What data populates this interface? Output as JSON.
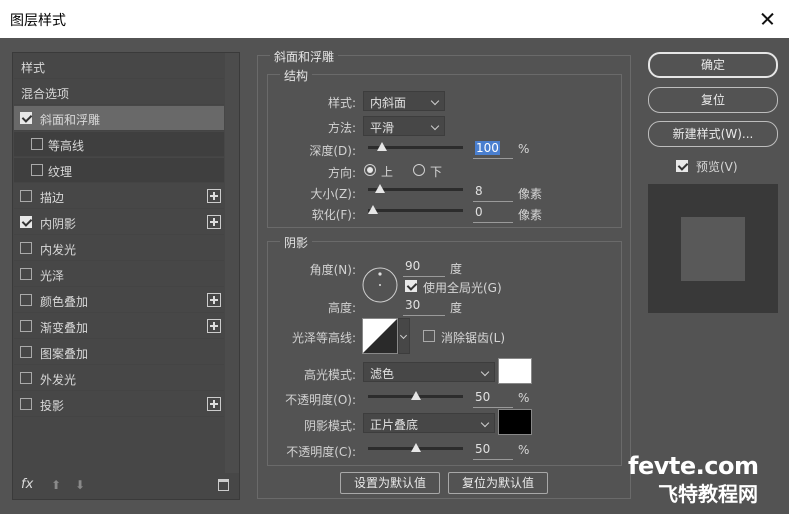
{
  "window": {
    "title": "图层样式"
  },
  "left_panel": {
    "items": [
      {
        "label": "样式",
        "checkbox": false,
        "checked": false,
        "plus": false,
        "sub": false,
        "selected": false
      },
      {
        "label": "混合选项",
        "checkbox": false,
        "checked": false,
        "plus": false,
        "sub": false,
        "selected": false
      },
      {
        "label": "斜面和浮雕",
        "checkbox": true,
        "checked": true,
        "plus": false,
        "sub": false,
        "selected": true
      },
      {
        "label": "等高线",
        "checkbox": true,
        "checked": false,
        "plus": false,
        "sub": true,
        "selected": false
      },
      {
        "label": "纹理",
        "checkbox": true,
        "checked": false,
        "plus": false,
        "sub": true,
        "selected": false
      },
      {
        "label": "描边",
        "checkbox": true,
        "checked": false,
        "plus": true,
        "sub": false,
        "selected": false
      },
      {
        "label": "内阴影",
        "checkbox": true,
        "checked": true,
        "plus": true,
        "sub": false,
        "selected": false
      },
      {
        "label": "内发光",
        "checkbox": true,
        "checked": false,
        "plus": false,
        "sub": false,
        "selected": false
      },
      {
        "label": "光泽",
        "checkbox": true,
        "checked": false,
        "plus": false,
        "sub": false,
        "selected": false
      },
      {
        "label": "颜色叠加",
        "checkbox": true,
        "checked": false,
        "plus": true,
        "sub": false,
        "selected": false
      },
      {
        "label": "渐变叠加",
        "checkbox": true,
        "checked": false,
        "plus": true,
        "sub": false,
        "selected": false
      },
      {
        "label": "图案叠加",
        "checkbox": true,
        "checked": false,
        "plus": false,
        "sub": false,
        "selected": false
      },
      {
        "label": "外发光",
        "checkbox": true,
        "checked": false,
        "plus": false,
        "sub": false,
        "selected": false
      },
      {
        "label": "投影",
        "checkbox": true,
        "checked": false,
        "plus": true,
        "sub": false,
        "selected": false
      }
    ],
    "fx_label": "fx"
  },
  "bevel": {
    "section_title": "斜面和浮雕",
    "structure": {
      "title": "结构",
      "style_label": "样式:",
      "style_value": "内斜面",
      "technique_label": "方法:",
      "technique_value": "平滑",
      "depth_label": "深度(D):",
      "depth_value": "100",
      "depth_unit": "%",
      "depth_level": 0.1,
      "direction_label": "方向:",
      "dir_up": "上",
      "dir_down": "下",
      "size_label": "大小(Z):",
      "size_value": "8",
      "size_unit": "像素",
      "size_level": 0.08,
      "soften_label": "软化(F):",
      "soften_value": "0",
      "soften_unit": "像素",
      "soften_level": 0.0
    },
    "shading": {
      "title": "阴影",
      "angle_label": "角度(N):",
      "angle_value": "90",
      "angle_unit": "度",
      "global_light_label": "使用全局光(G)",
      "altitude_label": "高度:",
      "altitude_value": "30",
      "altitude_unit": "度",
      "gloss_label": "光泽等高线:",
      "antialias_label": "消除锯齿(L)",
      "highlight_label": "高光模式:",
      "highlight_value": "滤色",
      "highlight_color": "#ffffff",
      "hl_opacity_label": "不透明度(O):",
      "hl_opacity_value": "50",
      "hl_opacity_unit": "%",
      "hl_opacity_level": 0.5,
      "shadow_label": "阴影模式:",
      "shadow_value": "正片叠底",
      "shadow_color": "#000000",
      "sh_opacity_label": "不透明度(C):",
      "sh_opacity_value": "50",
      "sh_opacity_unit": "%",
      "sh_opacity_level": 0.5
    },
    "make_default": "设置为默认值",
    "reset_default": "复位为默认值"
  },
  "buttons": {
    "ok": "确定",
    "reset": "复位",
    "new_style": "新建样式(W)...",
    "preview": "预览(V)"
  },
  "watermark": {
    "line1": "fevte.com",
    "line2": "飞特教程网"
  }
}
